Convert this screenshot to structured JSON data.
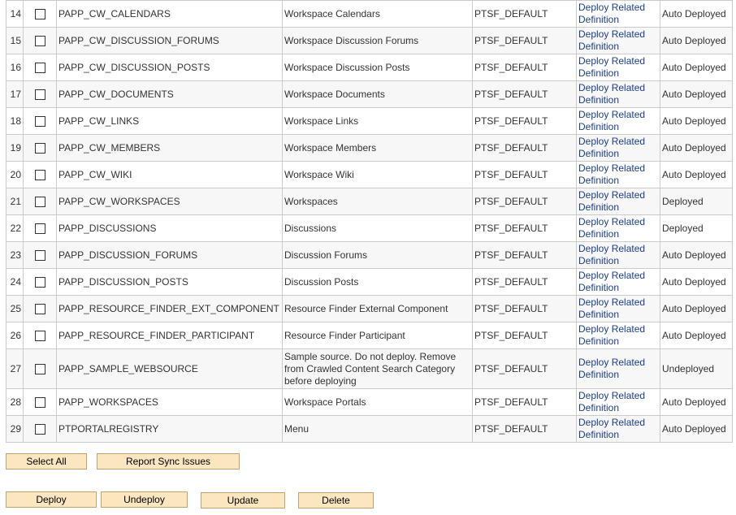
{
  "table": {
    "rows": [
      {
        "num": "14",
        "name": "PAPP_CW_CALENDARS",
        "desc": "Workspace Calendars",
        "node": "PTSF_DEFAULT",
        "action": "Deploy Related Definition",
        "status": "Auto Deployed"
      },
      {
        "num": "15",
        "name": "PAPP_CW_DISCUSSION_FORUMS",
        "desc": "Workspace Discussion Forums",
        "node": "PTSF_DEFAULT",
        "action": "Deploy Related Definition",
        "status": "Auto Deployed"
      },
      {
        "num": "16",
        "name": "PAPP_CW_DISCUSSION_POSTS",
        "desc": "Workspace Discussion Posts",
        "node": "PTSF_DEFAULT",
        "action": "Deploy Related Definition",
        "status": "Auto Deployed"
      },
      {
        "num": "17",
        "name": "PAPP_CW_DOCUMENTS",
        "desc": "Workspace Documents",
        "node": "PTSF_DEFAULT",
        "action": "Deploy Related Definition",
        "status": "Auto Deployed"
      },
      {
        "num": "18",
        "name": "PAPP_CW_LINKS",
        "desc": "Workspace Links",
        "node": "PTSF_DEFAULT",
        "action": "Deploy Related Definition",
        "status": "Auto Deployed"
      },
      {
        "num": "19",
        "name": "PAPP_CW_MEMBERS",
        "desc": "Workspace Members",
        "node": "PTSF_DEFAULT",
        "action": "Deploy Related Definition",
        "status": "Auto Deployed"
      },
      {
        "num": "20",
        "name": "PAPP_CW_WIKI",
        "desc": "Workspace Wiki",
        "node": "PTSF_DEFAULT",
        "action": "Deploy Related Definition",
        "status": "Auto Deployed"
      },
      {
        "num": "21",
        "name": "PAPP_CW_WORKSPACES",
        "desc": "Workspaces",
        "node": "PTSF_DEFAULT",
        "action": "Deploy Related Definition",
        "status": "Deployed"
      },
      {
        "num": "22",
        "name": "PAPP_DISCUSSIONS",
        "desc": "Discussions",
        "node": "PTSF_DEFAULT",
        "action": "Deploy Related Definition",
        "status": "Deployed"
      },
      {
        "num": "23",
        "name": "PAPP_DISCUSSION_FORUMS",
        "desc": "Discussion Forums",
        "node": "PTSF_DEFAULT",
        "action": "Deploy Related Definition",
        "status": "Auto Deployed"
      },
      {
        "num": "24",
        "name": "PAPP_DISCUSSION_POSTS",
        "desc": "Discussion Posts",
        "node": "PTSF_DEFAULT",
        "action": "Deploy Related Definition",
        "status": "Auto Deployed"
      },
      {
        "num": "25",
        "name": "PAPP_RESOURCE_FINDER_EXT_COMPONENT",
        "desc": "Resource Finder External Component",
        "node": "PTSF_DEFAULT",
        "action": "Deploy Related Definition",
        "status": "Auto Deployed"
      },
      {
        "num": "26",
        "name": "PAPP_RESOURCE_FINDER_PARTICIPANT",
        "desc": "Resource Finder Participant",
        "node": "PTSF_DEFAULT",
        "action": "Deploy Related Definition",
        "status": "Auto Deployed"
      },
      {
        "num": "27",
        "name": "PAPP_SAMPLE_WEBSOURCE",
        "desc": "Sample source. Do not deploy. Remove from Crawled Content Search Category before deploying",
        "node": "PTSF_DEFAULT",
        "action": "Deploy Related Definition",
        "status": "Undeployed"
      },
      {
        "num": "28",
        "name": "PAPP_WORKSPACES",
        "desc": "Workspace Portals",
        "node": "PTSF_DEFAULT",
        "action": "Deploy Related Definition",
        "status": "Auto Deployed"
      },
      {
        "num": "29",
        "name": "PTPORTALREGISTRY",
        "desc": "Menu",
        "node": "PTSF_DEFAULT",
        "action": "Deploy Related Definition",
        "status": "Auto Deployed"
      }
    ]
  },
  "buttons": {
    "select_all": "Select All",
    "report_sync": "Report Sync Issues",
    "deploy": "Deploy",
    "undeploy": "Undeploy",
    "update": "Update",
    "delete": "Delete"
  }
}
